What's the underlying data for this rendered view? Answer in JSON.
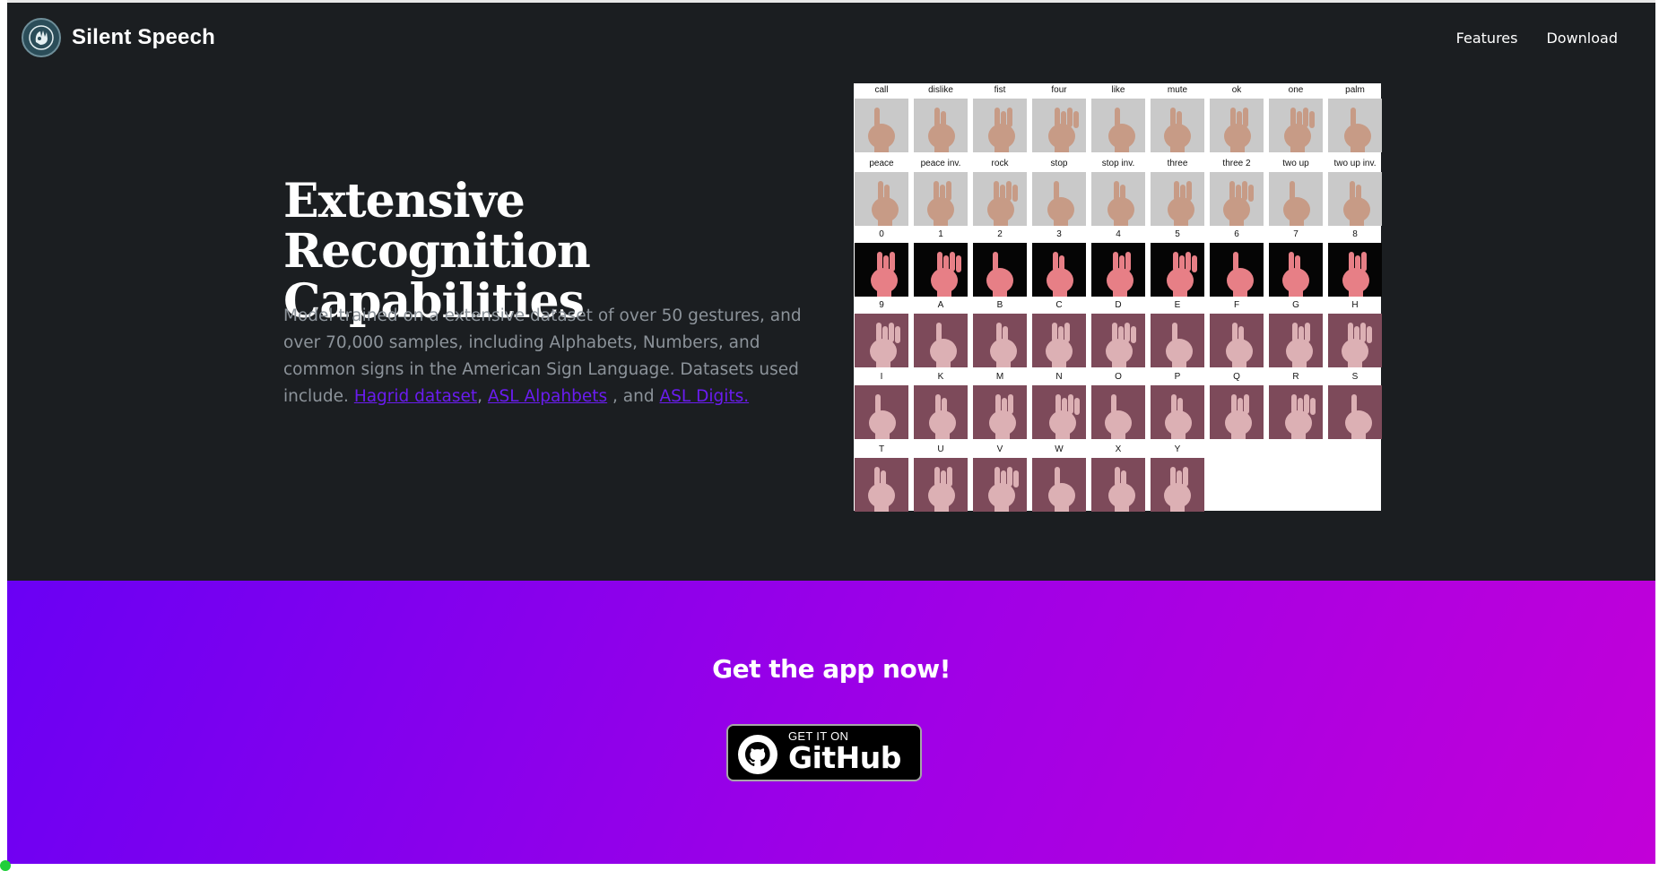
{
  "nav": {
    "brand_name": "Silent Speech",
    "logo_icon": "hand-sign-logo-icon",
    "links": [
      "Features",
      "Download"
    ]
  },
  "hero": {
    "title": "Extensive Recognition Capabilities",
    "description_text": "Model trained on a extensive dataset of over 50 gestures, and over 70,000 samples, including Alphabets, Numbers, and common signs in the American Sign Language. Datasets used include.",
    "links": {
      "hagrid": "Hagrid dataset",
      "asl_alphabets": "ASL Alpahbets",
      "asl_digits": "ASL Digits."
    },
    "separator_comma": ",",
    "separator_and": ", and"
  },
  "gesture_grid": {
    "rows": [
      [
        "call",
        "dislike",
        "fist",
        "four",
        "like",
        "mute",
        "ok",
        "one",
        "palm"
      ],
      [
        "peace",
        "peace inv.",
        "rock",
        "stop",
        "stop inv.",
        "three",
        "three 2",
        "two up",
        "two up inv."
      ],
      [
        "0",
        "1",
        "2",
        "3",
        "4",
        "5",
        "6",
        "7",
        "8"
      ],
      [
        "9",
        "A",
        "B",
        "C",
        "D",
        "E",
        "F",
        "G",
        "H"
      ],
      [
        "I",
        "K",
        "M",
        "N",
        "O",
        "P",
        "Q",
        "R",
        "S"
      ],
      [
        "T",
        "U",
        "V",
        "W",
        "X",
        "Y"
      ]
    ],
    "photo_backgrounds": {
      "gesture": "#c9c9c9",
      "digit": "#050505",
      "letter": "#7d4a5a"
    }
  },
  "cta": {
    "title": "Get the app now!",
    "badge_small": "GET IT ON",
    "badge_big": "GitHub",
    "badge_icon": "github-icon"
  },
  "colors": {
    "dark_bg": "#1b1e21",
    "link": "#6a1cf0",
    "gradient_start": "#6a00f4",
    "gradient_end": "#c200d8"
  }
}
